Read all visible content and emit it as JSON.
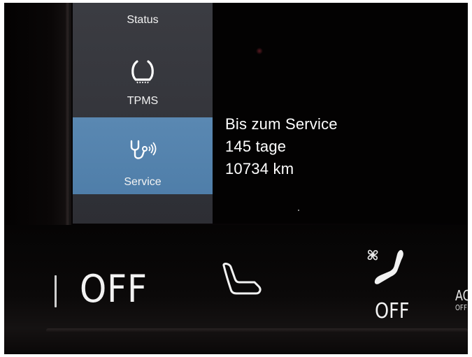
{
  "sidebar": {
    "items": [
      {
        "label": "Status",
        "icon": "status-icon",
        "selected": false
      },
      {
        "label": "TPMS",
        "icon": "tire-pressure-icon",
        "selected": false
      },
      {
        "label": "Service",
        "icon": "service-stethoscope-icon",
        "selected": true
      }
    ],
    "selected_color": "#4f7ea9"
  },
  "service_info": {
    "line1": "Bis zum Service",
    "line2": "145 tage",
    "line3": "10734 km"
  },
  "climate": {
    "left_off_label": "OFF",
    "seat_icon": "seat-heating-icon",
    "fan_icon": "fan-icon",
    "recline_icon": "seat-ventilation-icon",
    "right_off_label": "OFF",
    "ac_label": "AC",
    "ac_sub_label": "OFF"
  }
}
